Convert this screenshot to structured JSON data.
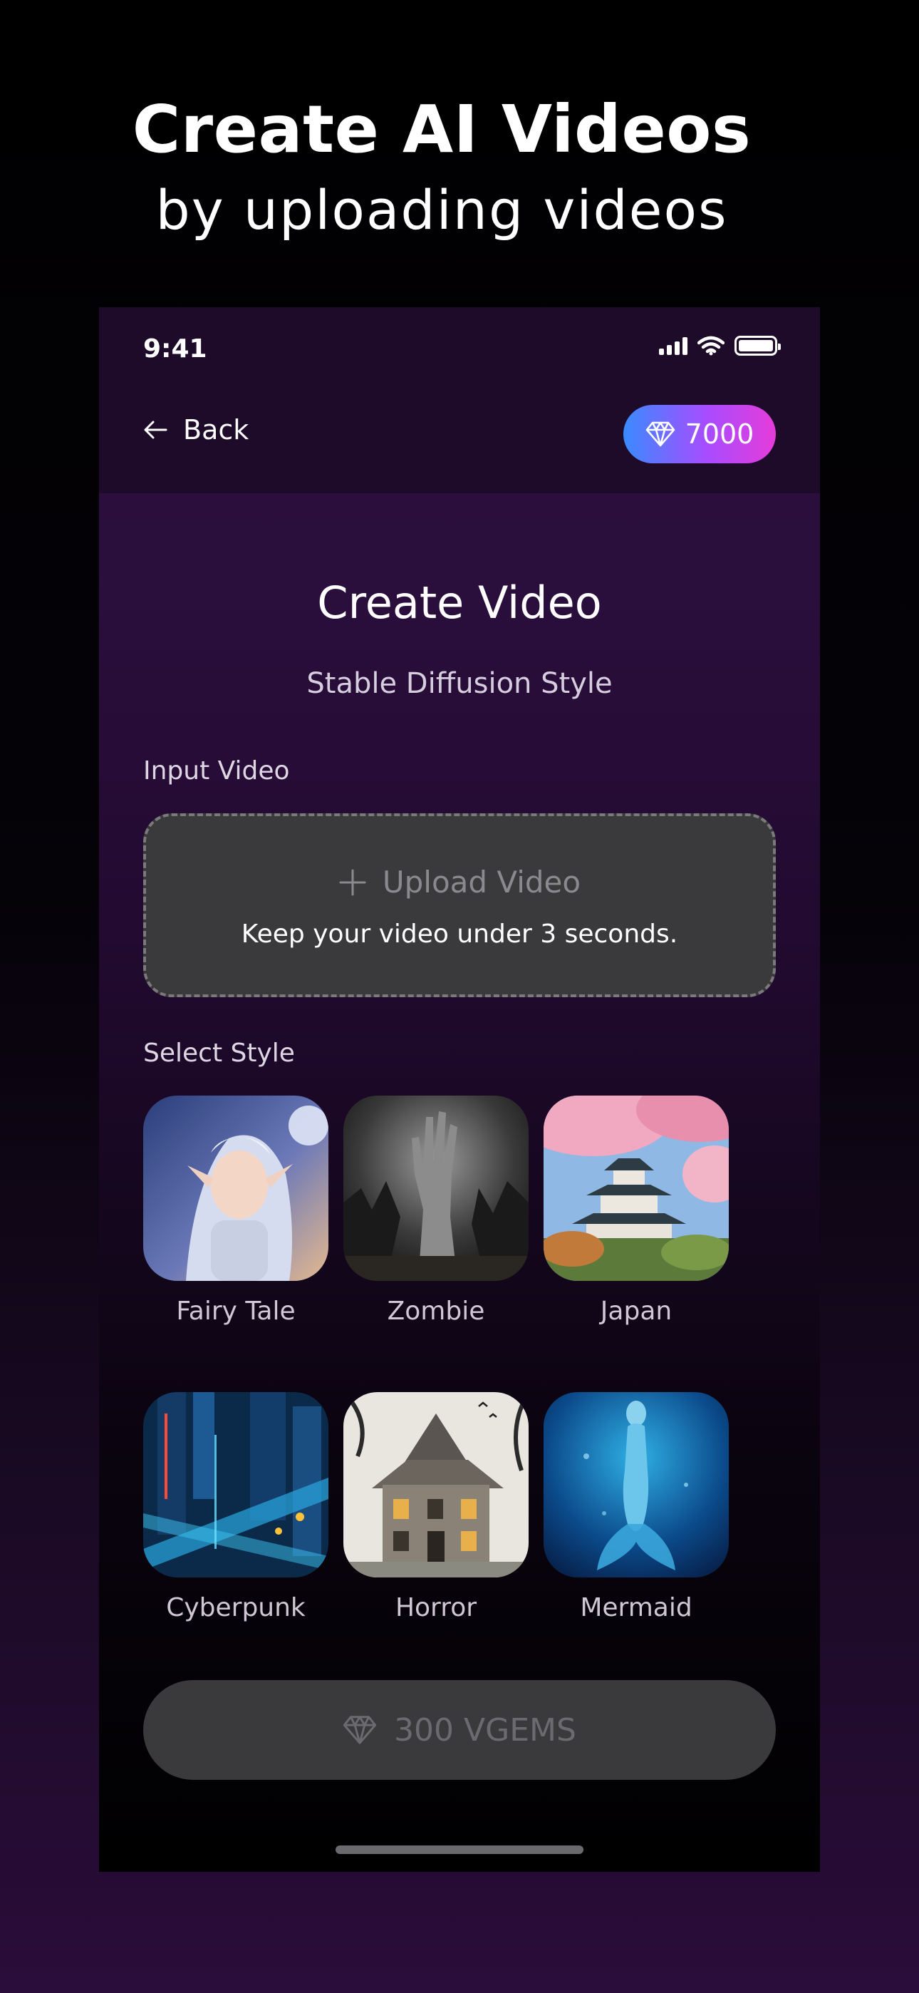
{
  "promo": {
    "title": "Create AI Videos",
    "subtitle": "by uploading videos"
  },
  "status_bar": {
    "time": "9:41",
    "icons": [
      "cellular-signal-icon",
      "wifi-icon",
      "battery-icon"
    ]
  },
  "nav": {
    "back_label": "Back",
    "back_icon": "arrow-left-icon",
    "gems_balance": "7000",
    "gems_icon": "diamond-icon"
  },
  "screen": {
    "title": "Create Video",
    "subtitle": "Stable Diffusion Style"
  },
  "input": {
    "label": "Input Video",
    "upload_label": "Upload Video",
    "upload_icon": "plus-icon",
    "hint": "Keep your video under 3 seconds."
  },
  "styles": {
    "label": "Select Style",
    "items": [
      {
        "label": "Fairy Tale"
      },
      {
        "label": "Zombie"
      },
      {
        "label": "Japan"
      },
      {
        "label": "Cyberpunk"
      },
      {
        "label": "Horror"
      },
      {
        "label": "Mermaid"
      }
    ]
  },
  "cta": {
    "label": "300 VGEMS",
    "icon": "diamond-icon"
  },
  "colors": {
    "accent_gradient_start": "#3a8bff",
    "accent_gradient_end": "#e63cd9",
    "disabled_button": "#3a3a3c",
    "background_purple": "#2a0e3c"
  }
}
